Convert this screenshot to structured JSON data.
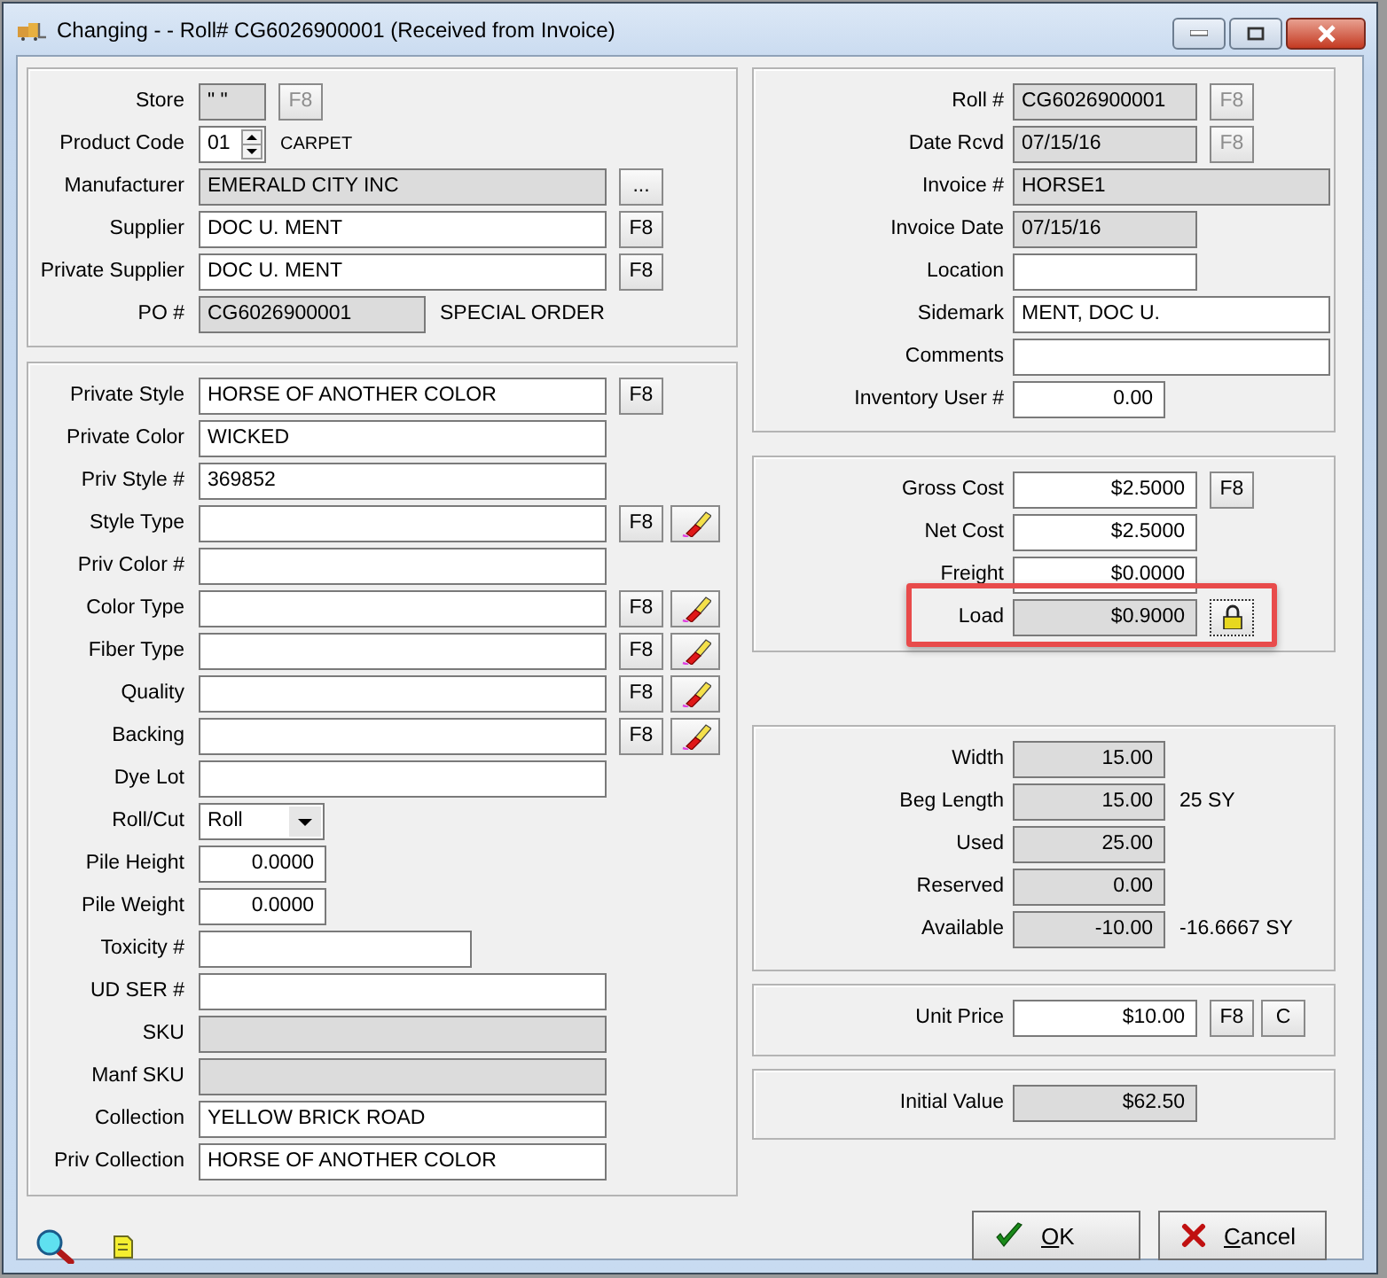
{
  "window": {
    "title": "Changing - - Roll# CG6026900001  (Received from Invoice)"
  },
  "left_panels": [
    {
      "rows": [
        {
          "label": "Store",
          "kind": "text",
          "value": "\" \"",
          "readonly": true,
          "highlighted": false,
          "buttons": [
            {
              "kind": "text",
              "label": "F8",
              "disabled": true
            }
          ]
        },
        {
          "label": "Product Code",
          "kind": "spin",
          "value": "01",
          "readonly": false,
          "highlighted": false,
          "note": "CARPET"
        },
        {
          "label": "Manufacturer",
          "kind": "text",
          "value": "EMERALD CITY INC",
          "readonly": true,
          "highlighted": false,
          "buttons": [
            {
              "kind": "text",
              "label": "...",
              "disabled": false
            }
          ]
        },
        {
          "label": "Supplier",
          "kind": "text",
          "value": "DOC U. MENT",
          "readonly": false,
          "highlighted": false,
          "buttons": [
            {
              "kind": "text",
              "label": "F8",
              "disabled": false
            }
          ]
        },
        {
          "label": "Private Supplier",
          "kind": "text",
          "value": "DOC U. MENT",
          "readonly": false,
          "highlighted": false,
          "buttons": [
            {
              "kind": "text",
              "label": "F8",
              "disabled": false
            }
          ]
        },
        {
          "label": "PO #",
          "kind": "text",
          "value": "CG6026900001",
          "readonly": true,
          "highlighted": false,
          "note": "SPECIAL ORDER"
        }
      ]
    },
    {
      "rows": [
        {
          "label": "Private Style",
          "kind": "text",
          "value": "HORSE OF ANOTHER COLOR",
          "readonly": false,
          "highlighted": false,
          "buttons": [
            {
              "kind": "text",
              "label": "F8",
              "disabled": false
            }
          ]
        },
        {
          "label": "Private Color",
          "kind": "text",
          "value": "WICKED",
          "readonly": false,
          "highlighted": false
        },
        {
          "label": "Priv Style #",
          "kind": "text",
          "value": "369852",
          "readonly": false,
          "highlighted": false
        },
        {
          "label": "Style Type",
          "kind": "text",
          "readonly": false,
          "highlighted": false,
          "buttons": [
            {
              "kind": "text",
              "label": "F8",
              "disabled": false
            },
            {
              "kind": "eraser",
              "disabled": false
            }
          ]
        },
        {
          "label": "Priv Color #",
          "kind": "text",
          "readonly": false,
          "highlighted": false
        },
        {
          "label": "Color Type",
          "kind": "text",
          "readonly": false,
          "highlighted": false,
          "buttons": [
            {
              "kind": "text",
              "label": "F8",
              "disabled": false
            },
            {
              "kind": "eraser",
              "disabled": false
            }
          ]
        },
        {
          "label": "Fiber Type",
          "kind": "text",
          "readonly": false,
          "highlighted": false,
          "buttons": [
            {
              "kind": "text",
              "label": "F8",
              "disabled": false
            },
            {
              "kind": "eraser",
              "disabled": false
            }
          ]
        },
        {
          "label": "Quality",
          "kind": "text",
          "readonly": false,
          "highlighted": false,
          "buttons": [
            {
              "kind": "text",
              "label": "F8",
              "disabled": false
            },
            {
              "kind": "eraser",
              "disabled": false
            }
          ]
        },
        {
          "label": "Backing",
          "kind": "text",
          "readonly": false,
          "highlighted": false,
          "buttons": [
            {
              "kind": "text",
              "label": "F8",
              "disabled": false
            },
            {
              "kind": "eraser",
              "disabled": false
            }
          ]
        },
        {
          "label": "Dye Lot",
          "kind": "text",
          "readonly": false,
          "highlighted": false
        },
        {
          "label": "Roll/Cut",
          "kind": "select",
          "value": "Roll",
          "readonly": false,
          "highlighted": false
        },
        {
          "label": "Pile Height",
          "kind": "number",
          "value": "0.0000",
          "readonly": false,
          "highlighted": false
        },
        {
          "label": "Pile Weight",
          "kind": "number",
          "value": "0.0000",
          "readonly": false,
          "highlighted": false
        },
        {
          "label": "Toxicity #",
          "kind": "text",
          "readonly": false,
          "highlighted": false
        },
        {
          "label": "UD SER #",
          "kind": "text",
          "readonly": false,
          "highlighted": false
        },
        {
          "label": "SKU",
          "kind": "text",
          "readonly": true,
          "highlighted": false
        },
        {
          "label": "Manf SKU",
          "kind": "text",
          "readonly": true,
          "highlighted": false
        },
        {
          "label": "Collection",
          "kind": "text",
          "value": "YELLOW BRICK ROAD",
          "readonly": false,
          "highlighted": false
        },
        {
          "label": "Priv Collection",
          "kind": "text",
          "value": "HORSE OF ANOTHER COLOR",
          "readonly": false,
          "highlighted": false
        }
      ]
    }
  ],
  "right_panels": [
    {
      "rows": [
        {
          "label": "Roll #",
          "kind": "text",
          "value": "CG6026900001",
          "readonly": true,
          "highlighted": false,
          "buttons": [
            {
              "kind": "text",
              "label": "F8",
              "disabled": true
            }
          ]
        },
        {
          "label": "Date Rcvd",
          "kind": "text",
          "value": "07/15/16",
          "readonly": true,
          "highlighted": false,
          "buttons": [
            {
              "kind": "text",
              "label": "F8",
              "disabled": true
            }
          ]
        },
        {
          "label": "Invoice #",
          "kind": "text",
          "value": "HORSE1",
          "readonly": true,
          "highlighted": false
        },
        {
          "label": "Invoice Date",
          "kind": "text",
          "value": "07/15/16",
          "readonly": true,
          "highlighted": false
        },
        {
          "label": "Location",
          "kind": "text",
          "readonly": false,
          "highlighted": false
        },
        {
          "label": "Sidemark",
          "kind": "text",
          "value": "MENT, DOC U.",
          "readonly": false,
          "highlighted": false
        },
        {
          "label": "Comments",
          "kind": "text",
          "readonly": false,
          "highlighted": false
        },
        {
          "label": "Inventory User #",
          "kind": "number",
          "value": "0.00",
          "readonly": false,
          "highlighted": false
        }
      ]
    },
    {
      "rows": [
        {
          "label": "Gross Cost",
          "kind": "number",
          "value": "$2.5000",
          "readonly": false,
          "highlighted": false,
          "buttons": [
            {
              "kind": "text",
              "label": "F8",
              "disabled": false
            }
          ]
        },
        {
          "label": "Net Cost",
          "kind": "number",
          "value": "$2.5000",
          "readonly": false,
          "highlighted": false
        },
        {
          "label": "Freight",
          "kind": "number",
          "value": "$0.0000",
          "readonly": false,
          "highlighted": false
        },
        {
          "label": "Load",
          "kind": "number",
          "value": "$0.9000",
          "readonly": true,
          "highlighted": true,
          "buttons": [
            {
              "kind": "lock",
              "disabled": false
            }
          ]
        }
      ]
    },
    {
      "rows": [
        {
          "label": "Width",
          "kind": "number",
          "value": "15.00",
          "readonly": true,
          "highlighted": false
        },
        {
          "label": "Beg Length",
          "kind": "number",
          "value": "15.00",
          "readonly": true,
          "highlighted": false,
          "note": "25 SY"
        },
        {
          "label": "Used",
          "kind": "number",
          "value": "25.00",
          "readonly": true,
          "highlighted": false
        },
        {
          "label": "Reserved",
          "kind": "number",
          "value": "0.00",
          "readonly": true,
          "highlighted": false
        },
        {
          "label": "Available",
          "kind": "number",
          "value": "-10.00",
          "readonly": true,
          "highlighted": false,
          "note": "-16.6667 SY"
        }
      ]
    },
    {
      "rows": [
        {
          "label": "Unit Price",
          "kind": "number",
          "value": "$10.00",
          "readonly": false,
          "highlighted": false,
          "buttons": [
            {
              "kind": "text",
              "label": "F8",
              "disabled": false
            },
            {
              "kind": "text",
              "label": "C",
              "disabled": false
            }
          ]
        }
      ]
    },
    {
      "rows": [
        {
          "label": "Initial Value",
          "kind": "number",
          "value": "$62.50",
          "readonly": true,
          "highlighted": false
        }
      ]
    }
  ],
  "buttons": [
    {
      "kind": "ok",
      "access_key": "O",
      "label_rest": "K"
    },
    {
      "kind": "cancel",
      "access_key": "C",
      "label_rest": "ancel"
    }
  ]
}
